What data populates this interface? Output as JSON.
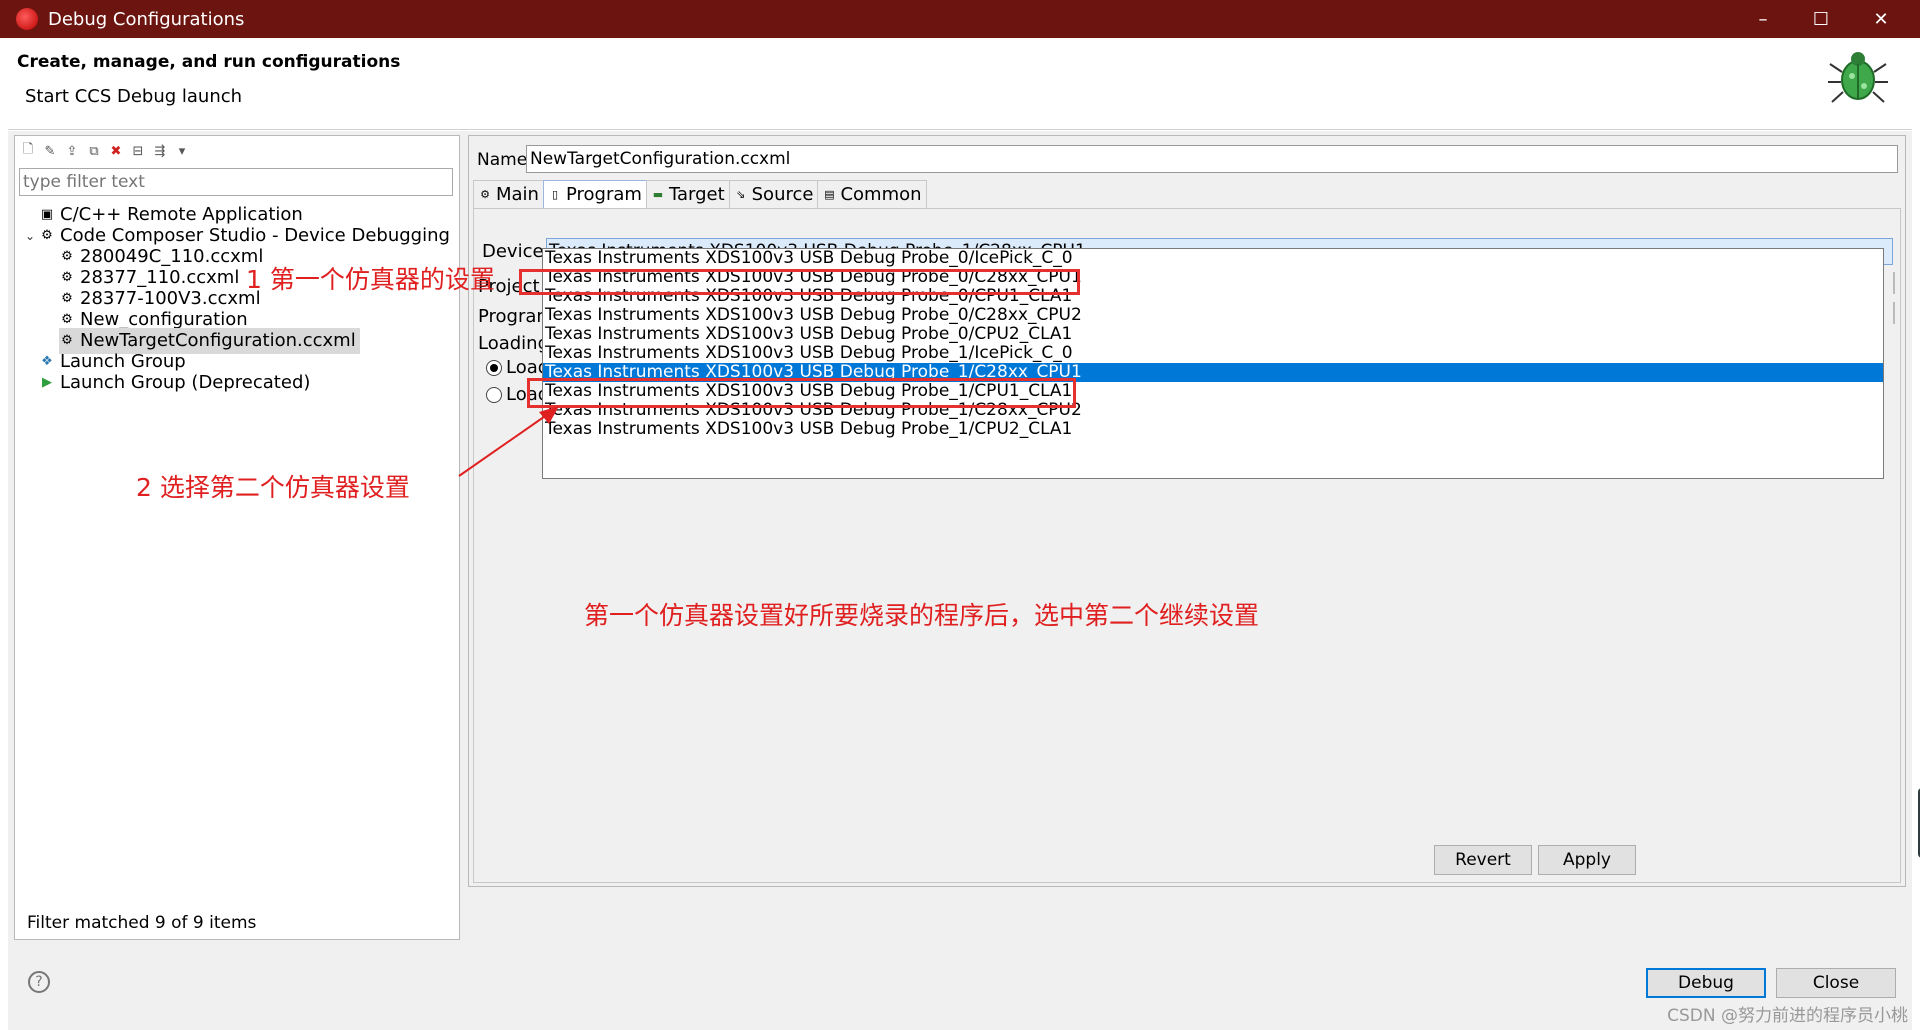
{
  "window": {
    "title": "Debug Configurations",
    "controls": {
      "minimize": "–",
      "maximize": "☐",
      "close": "✕"
    }
  },
  "header": {
    "title": "Create, manage, and run configurations",
    "subtitle": "Start CCS Debug launch"
  },
  "left": {
    "filter_placeholder": "type filter text",
    "tree": [
      {
        "label": "C/C++ Remote Application",
        "icon": "cpp-remote-icon"
      },
      {
        "label": "Code Composer Studio - Device Debugging",
        "icon": "ccs-debug-icon",
        "expanded": true
      },
      {
        "label": "280049C_110.ccxml",
        "icon": "target-config-icon"
      },
      {
        "label": "28377_110.ccxml",
        "icon": "target-config-icon"
      },
      {
        "label": "28377-100V3.ccxml",
        "icon": "target-config-icon"
      },
      {
        "label": "New_configuration",
        "icon": "target-config-icon"
      },
      {
        "label": "NewTargetConfiguration.ccxml",
        "icon": "target-config-icon",
        "selected": true
      },
      {
        "label": "Launch Group",
        "icon": "launch-group-icon"
      },
      {
        "label": "Launch Group (Deprecated)",
        "icon": "launch-group-deprecated-icon"
      }
    ],
    "status": "Filter matched 9 of 9 items"
  },
  "right": {
    "name_label": "Name:",
    "name_value": "NewTargetConfiguration.ccxml",
    "tabs": [
      {
        "label": "Main",
        "icon": "main-tab-icon"
      },
      {
        "label": "Program",
        "icon": "program-tab-icon",
        "active": true
      },
      {
        "label": "Target",
        "icon": "target-tab-icon"
      },
      {
        "label": "Source",
        "icon": "source-tab-icon"
      },
      {
        "label": "Common",
        "icon": "common-tab-icon"
      }
    ],
    "device_label": "Device",
    "device_value": "Texas Instruments XDS100v3 USB Debug Probe_1/C28xx_CPU1",
    "project_label": "Project",
    "program_label": "Program",
    "loading_label": "Loading",
    "load_option_1": "Load",
    "load_option_2": "Load",
    "dropdown_options": [
      "Texas Instruments XDS100v3 USB Debug Probe_0/IcePick_C_0",
      "Texas Instruments XDS100v3 USB Debug Probe_0/C28xx_CPU1",
      "Texas Instruments XDS100v3 USB Debug Probe_0/CPU1_CLA1",
      "Texas Instruments XDS100v3 USB Debug Probe_0/C28xx_CPU2",
      "Texas Instruments XDS100v3 USB Debug Probe_0/CPU2_CLA1",
      "Texas Instruments XDS100v3 USB Debug Probe_1/IcePick_C_0",
      "Texas Instruments XDS100v3 USB Debug Probe_1/C28xx_CPU1",
      "Texas Instruments XDS100v3 USB Debug Probe_1/CPU1_CLA1",
      "Texas Instruments XDS100v3 USB Debug Probe_1/C28xx_CPU2",
      "Texas Instruments XDS100v3 USB Debug Probe_1/CPU2_CLA1"
    ],
    "selected_option_index": 6,
    "revert": "Revert",
    "apply": "Apply"
  },
  "footer": {
    "help": "?",
    "debug": "Debug",
    "close": "Close"
  },
  "annotations": {
    "note1": "1 第一个仿真器的设置",
    "note2": "2 选择第二个仿真器设置",
    "note3": "第一个仿真器设置好所要烧录的程序后，选中第二个继续设置"
  },
  "watermark": "CSDN @努力前进的程序员小桃",
  "colors": {
    "titlebar": "#6b1410",
    "selection": "#0078d7",
    "annotation": "#e02020"
  }
}
